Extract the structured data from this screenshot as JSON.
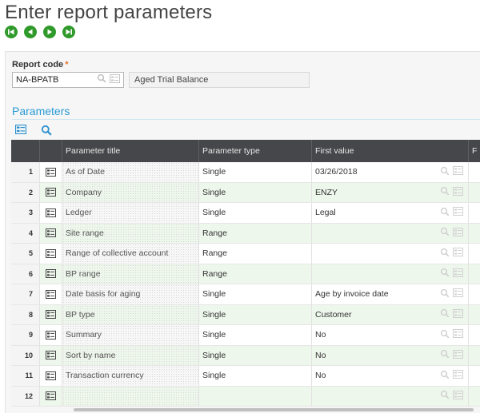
{
  "page": {
    "title": "Enter report parameters"
  },
  "nav": {
    "first": "first-record-icon",
    "previous": "previous-record-icon",
    "next": "next-record-icon",
    "last": "last-record-icon"
  },
  "report": {
    "label": "Report code",
    "required_mark": "*",
    "code": "NA-BPATB",
    "description": "Aged Trial Balance"
  },
  "parameters": {
    "section_title": "Parameters",
    "columns": {
      "title": "Parameter title",
      "type": "Parameter type",
      "first": "First value",
      "more": "F"
    },
    "rows": [
      {
        "num": "1",
        "title": "As of Date",
        "type": "Single",
        "first": "03/26/2018"
      },
      {
        "num": "2",
        "title": "Company",
        "type": "Single",
        "first": "ENZY"
      },
      {
        "num": "3",
        "title": "Ledger",
        "type": "Single",
        "first": "Legal"
      },
      {
        "num": "4",
        "title": "Site range",
        "type": "Range",
        "first": ""
      },
      {
        "num": "5",
        "title": "Range of collective account",
        "type": "Range",
        "first": ""
      },
      {
        "num": "6",
        "title": "BP range",
        "type": "Range",
        "first": ""
      },
      {
        "num": "7",
        "title": "Date basis for aging",
        "type": "Single",
        "first": "Age by invoice date"
      },
      {
        "num": "8",
        "title": "BP type",
        "type": "Single",
        "first": "Customer"
      },
      {
        "num": "9",
        "title": "Summary",
        "type": "Single",
        "first": "No"
      },
      {
        "num": "10",
        "title": "Sort by name",
        "type": "Single",
        "first": "No"
      },
      {
        "num": "11",
        "title": "Transaction currency",
        "type": "Single",
        "first": "No"
      },
      {
        "num": "12",
        "title": "",
        "type": "",
        "first": ""
      }
    ]
  },
  "colors": {
    "accent": "#2a9bd6",
    "nav_green": "#2f9a2a",
    "header_bg": "#45474a",
    "row_alt": "#eef7ec",
    "required": "#e8712b"
  }
}
